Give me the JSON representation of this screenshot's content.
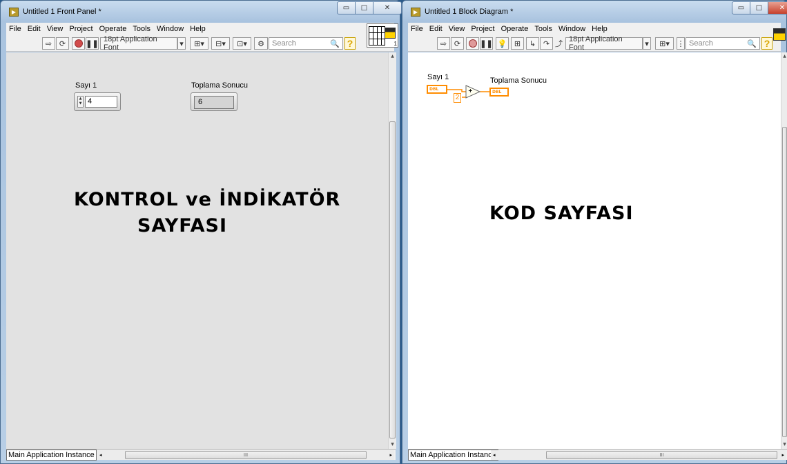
{
  "front_panel": {
    "title": "Untitled 1 Front Panel *",
    "menu": [
      "File",
      "Edit",
      "View",
      "Project",
      "Operate",
      "Tools",
      "Window",
      "Help"
    ],
    "toolbar": {
      "font": "18pt Application Font",
      "search_placeholder": "Search"
    },
    "controls": {
      "sayi1_label": "Sayı 1",
      "sayi1_value": "4",
      "result_label": "Toplama Sonucu",
      "result_value": "6"
    },
    "heading_line1": "KONTROL ve İNDİKATÖR",
    "heading_line2": "SAYFASI",
    "status": "Main Application Instance",
    "connector_number": "1"
  },
  "block_diagram": {
    "title": "Untitled 1 Block Diagram *",
    "menu": [
      "File",
      "Edit",
      "View",
      "Project",
      "Operate",
      "Tools",
      "Window",
      "Help"
    ],
    "toolbar": {
      "font": "18pt Application Font",
      "search_placeholder": "Search"
    },
    "nodes": {
      "sayi1_label": "Sayı 1",
      "sayi1_type": "DBL",
      "constant": "2",
      "add_symbol": "+",
      "result_label": "Toplama Sonucu",
      "result_type": "DBL"
    },
    "heading": "KOD SAYFASI",
    "status": "Main Application Instance"
  },
  "colors": {
    "wire_orange": "#ff8c00",
    "panel_gray": "#e2e2e2"
  }
}
